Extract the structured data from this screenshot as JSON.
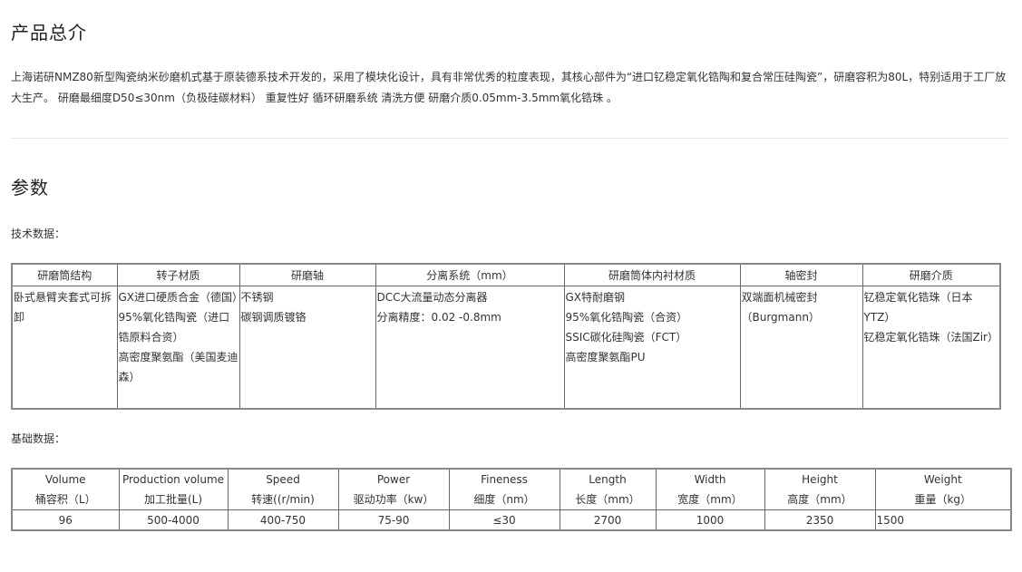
{
  "overview": {
    "title": "产品总介",
    "description": "上海诺研NMZ80新型陶瓷纳米砂磨机式基于原装德系技术开发的，采用了模块化设计，具有非常优秀的粒度表现，其核心部件为“进口钇稳定氧化锆陶和复合常压硅陶瓷”，研磨容积为80L，特别适用于工厂放大生产。 研磨最细度D50≤30nm（负极硅碳材料） 重复性好 循环研磨系统 清洗方便 研磨介质0.05mm-3.5mm氧化锆珠 。"
  },
  "params": {
    "title": "参数",
    "tech_label": "技术数据：",
    "tech_table": {
      "headers": [
        "研磨筒结构",
        "转子材质",
        "研磨轴",
        "分离系统（mm）",
        "研磨筒体内衬材质",
        "轴密封",
        "研磨介质"
      ],
      "cells": [
        [
          "卧式悬臂夹套式可拆卸"
        ],
        [
          "GX进口硬质合金（德国）",
          "95%氧化锆陶瓷（进口锆原料合资）",
          "高密度聚氨酯（美国麦迪森）"
        ],
        [
          "不锈钢",
          "碳钢调质镀铬"
        ],
        [
          "DCC大流量动态分离器",
          "分离精度：0.02 -0.8mm"
        ],
        [
          "GX特耐磨钢",
          "95%氧化锆陶瓷（合资）",
          "SSIC碳化硅陶瓷（FCT）",
          "高密度聚氨酯PU"
        ],
        [
          "双端面机械密封",
          "（Burgmann）"
        ],
        [
          "钇稳定氧化锆珠（日本YTZ）",
          "钇稳定氧化锆珠（法国Zir）"
        ]
      ]
    },
    "basic_label": "基础数据：",
    "basic_table": {
      "headers": [
        {
          "en": "Volume",
          "cn": "桶容积（L）"
        },
        {
          "en": "Production volume",
          "cn": "加工批量(L)"
        },
        {
          "en": "Speed",
          "cn": "转速((r/min)"
        },
        {
          "en": "Power",
          "cn": "驱动功率（kw）"
        },
        {
          "en": "Fineness",
          "cn": "细度（nm）"
        },
        {
          "en": "Length",
          "cn": "长度（mm）"
        },
        {
          "en": "Width",
          "cn": "宽度（mm）"
        },
        {
          "en": "Height",
          "cn": "高度（mm）"
        },
        {
          "en": "Weight",
          "cn": "重量（kg）"
        }
      ],
      "row": [
        "96",
        "500-4000",
        "400-750",
        "75-90",
        "≤30",
        "2700",
        "1000",
        "2350",
        "1500"
      ]
    }
  }
}
